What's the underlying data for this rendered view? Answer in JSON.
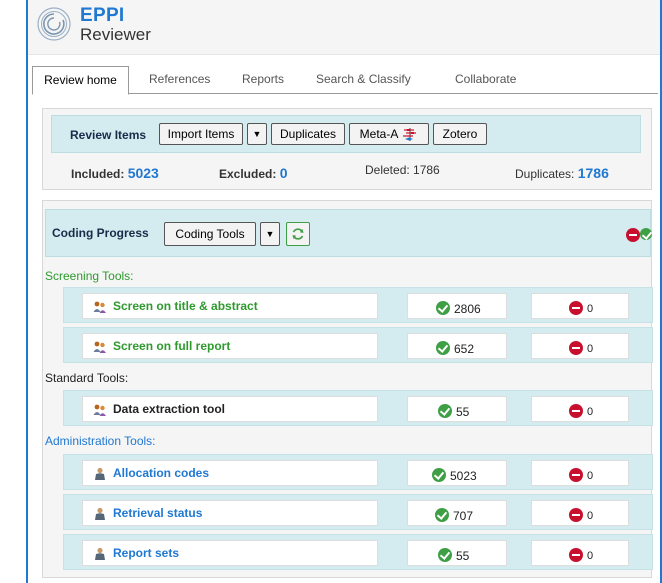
{
  "header": {
    "logo_top": "EPPI",
    "logo_bottom": "Reviewer"
  },
  "tabs": [
    {
      "label": "Review home",
      "active": true
    },
    {
      "label": "References"
    },
    {
      "label": "Reports"
    },
    {
      "label": "Search & Classify"
    },
    {
      "label": "Collaborate"
    }
  ],
  "review_items": {
    "title": "Review Items",
    "import_label": "Import Items",
    "dropdown_glyph": "▼",
    "duplicates_label": "Duplicates",
    "meta_a_label": "Meta-A",
    "zotero_label": "Zotero",
    "included_label": "Included:",
    "included_value": "5023",
    "excluded_label": "Excluded:",
    "excluded_value": "0",
    "deleted_text": "Deleted: 1786",
    "duplicates_count_label": "Duplicates:",
    "duplicates_count_value": "1786"
  },
  "coding_progress": {
    "title": "Coding Progress",
    "coding_tools_label": "Coding Tools",
    "dropdown_glyph": "▼",
    "sections": [
      {
        "label": "Screening Tools:",
        "color": "#2e9a2e",
        "tools": [
          {
            "name": "Screen on title & abstract",
            "ok": "2806",
            "no": "0",
            "icon": "people-icon"
          },
          {
            "name": "Screen on full report",
            "ok": "652",
            "no": "0",
            "icon": "people-icon"
          }
        ]
      },
      {
        "label": "Standard Tools:",
        "color": "#222222",
        "tools": [
          {
            "name": "Data extraction tool",
            "ok": "55",
            "no": "0",
            "icon": "people-icon"
          }
        ]
      },
      {
        "label": "Administration Tools:",
        "color": "#1f78d1",
        "tools": [
          {
            "name": "Allocation codes",
            "ok": "5023",
            "no": "0",
            "icon": "admin-person-icon"
          },
          {
            "name": "Retrieval status",
            "ok": "707",
            "no": "0",
            "icon": "admin-person-icon"
          },
          {
            "name": "Report sets",
            "ok": "55",
            "no": "0",
            "icon": "admin-person-icon"
          }
        ]
      }
    ]
  },
  "colors": {
    "accent": "#1f78d1",
    "bar": "#d4ecef",
    "green": "#2e9a2e",
    "red": "#c8102e"
  }
}
